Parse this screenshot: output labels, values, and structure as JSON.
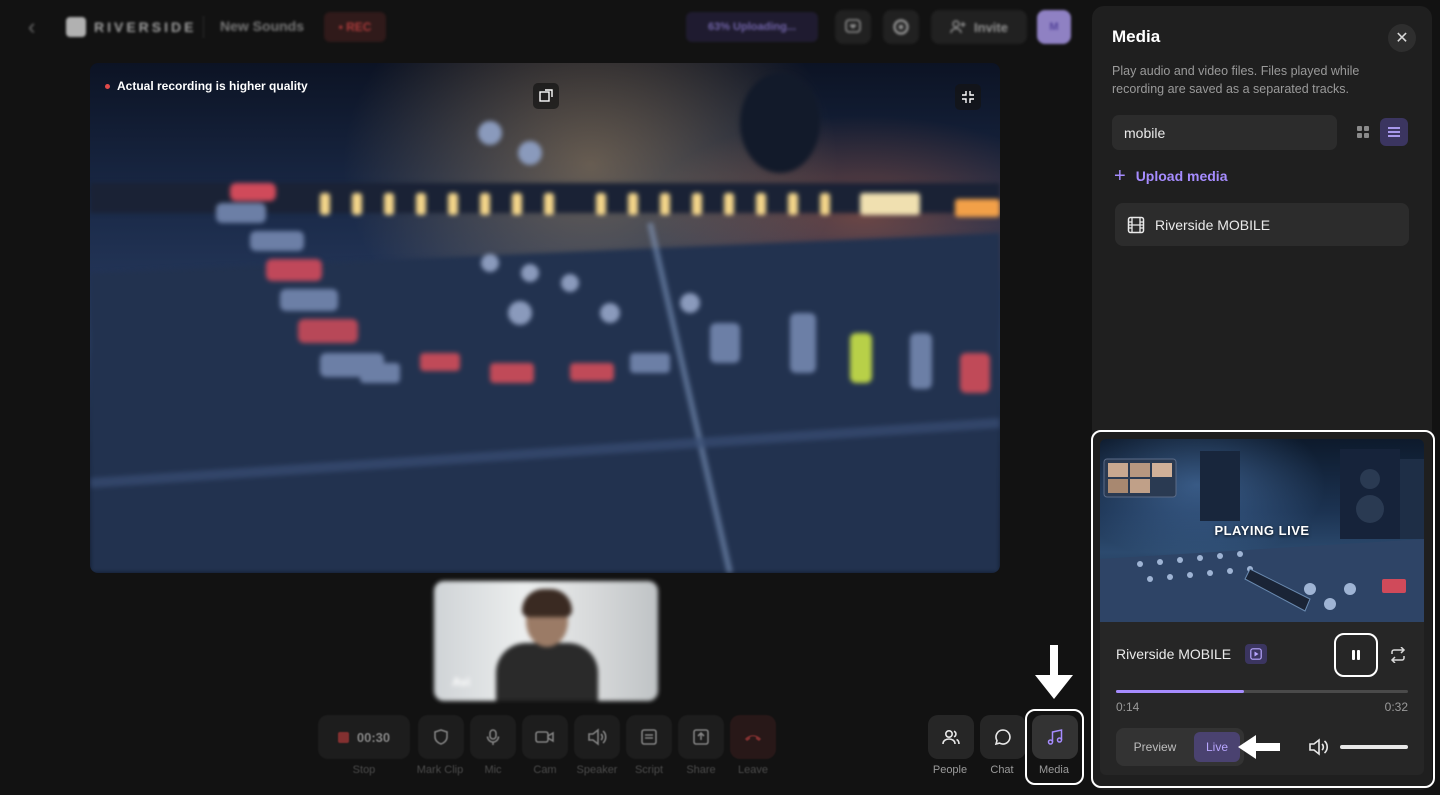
{
  "topbar": {
    "brand": "RIVERSIDE",
    "project_title": "New Sounds",
    "rec_label": "• REC",
    "upload_status": "63% Uploading...",
    "invite_label": "Invite",
    "avatar_initials": "M"
  },
  "main_video": {
    "quality_note": "Actual recording is higher quality"
  },
  "self_view": {
    "name": "Avi"
  },
  "controls": {
    "timer": "00:30",
    "items": [
      {
        "label": "Stop",
        "icon": "stop-icon"
      },
      {
        "label": "Mark Clip",
        "icon": "shield-icon"
      },
      {
        "label": "Mic",
        "icon": "mic-icon"
      },
      {
        "label": "Cam",
        "icon": "camera-icon"
      },
      {
        "label": "Speaker",
        "icon": "speaker-icon"
      },
      {
        "label": "Script",
        "icon": "script-icon"
      },
      {
        "label": "Share",
        "icon": "share-icon"
      },
      {
        "label": "Leave",
        "icon": "phone-hangup-icon"
      }
    ],
    "right_items": [
      {
        "label": "People",
        "icon": "people-icon"
      },
      {
        "label": "Chat",
        "icon": "chat-icon"
      },
      {
        "label": "Media",
        "icon": "music-note-icon"
      }
    ]
  },
  "media_panel": {
    "title": "Media",
    "description": "Play audio and video files. Files played while recording are saved as a separated tracks.",
    "search_value": "mobile",
    "upload_label": "Upload media",
    "items": [
      {
        "name": "Riverside MOBILE",
        "icon": "film-icon"
      }
    ]
  },
  "player": {
    "overlay": "PLAYING LIVE",
    "track_name": "Riverside MOBILE",
    "progress": 0.44,
    "time_current": "0:14",
    "time_total": "0:32",
    "mode_preview": "Preview",
    "mode_live": "Live",
    "selected_mode": "Live",
    "volume": 1.0
  },
  "colors": {
    "accent": "#a68cff",
    "panel_bg": "#1f1f1f",
    "app_bg": "#121212",
    "rec_red": "#e04a4a"
  }
}
